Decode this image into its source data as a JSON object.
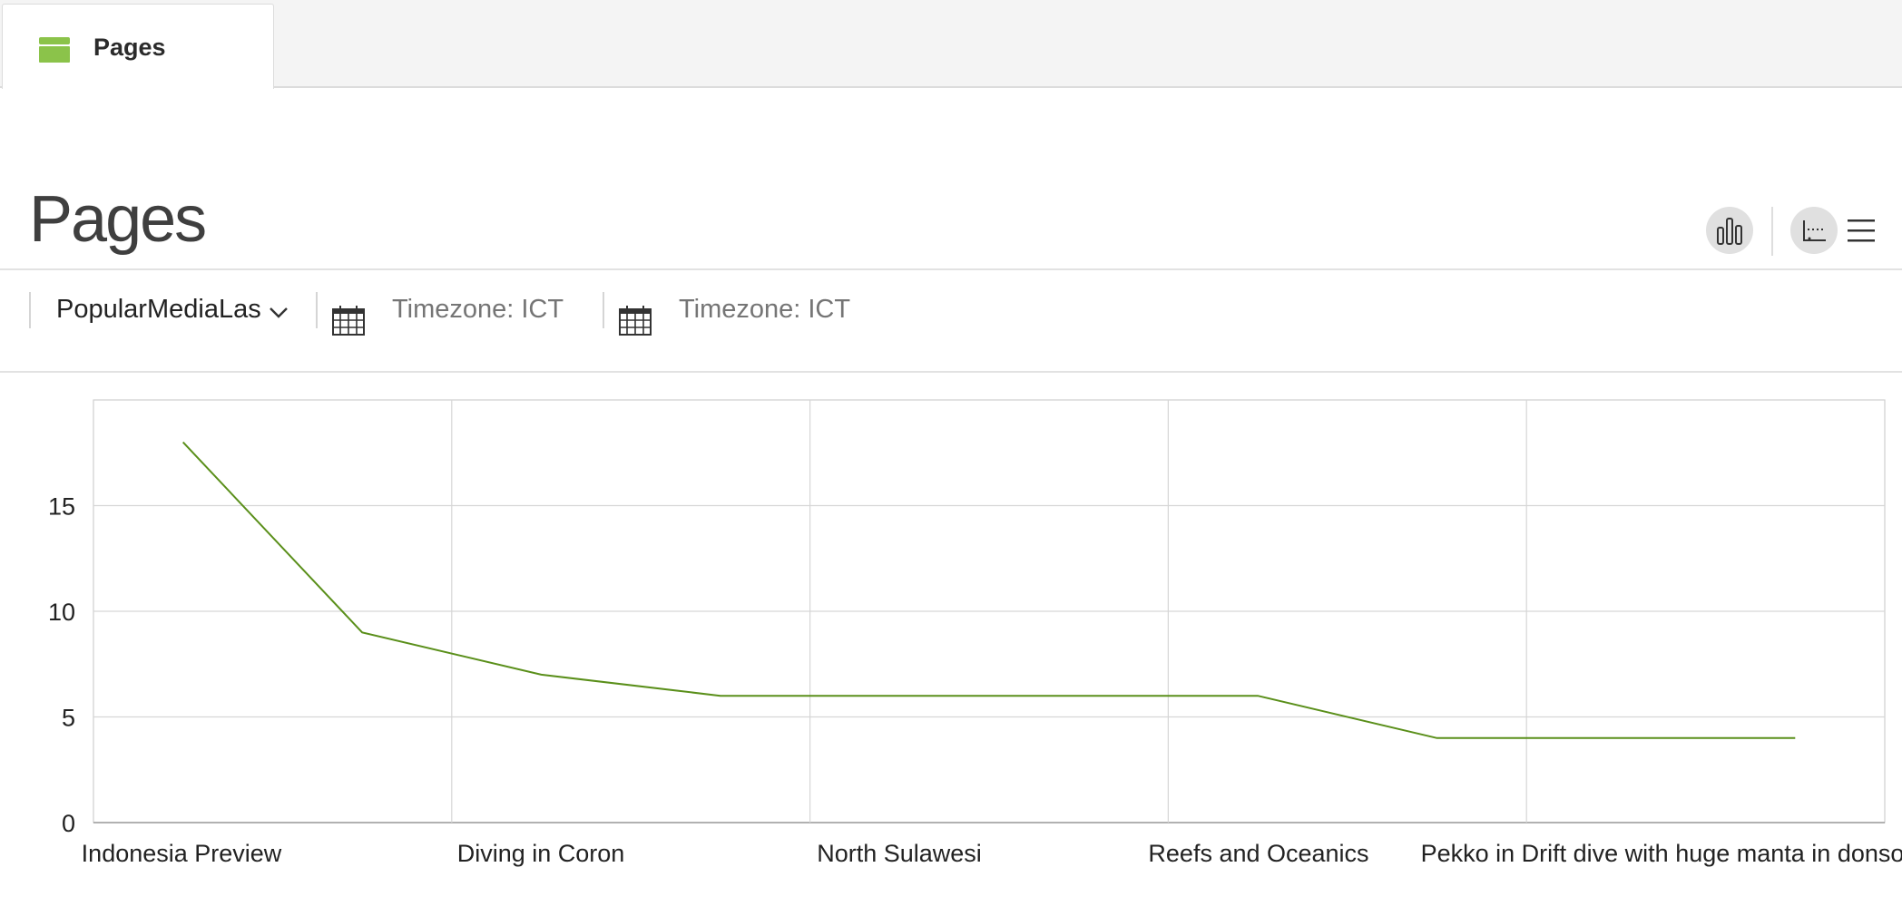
{
  "tab": {
    "label": "Pages",
    "icon": "folder-icon",
    "icon_color": "#8bc34a"
  },
  "page": {
    "title": "Pages"
  },
  "toolbar": {
    "chart_view_icon": "bar-chart-icon",
    "series_toggle_icon": "line-series-icon",
    "menu_icon": "hamburger-menu-icon"
  },
  "filters": {
    "report_select": {
      "value": "PopularMediaLast"
    },
    "start_date": {
      "placeholder": "Timezone: ICT",
      "icon": "calendar-icon"
    },
    "end_date": {
      "placeholder": "Timezone: ICT",
      "icon": "calendar-icon"
    }
  },
  "chart_data": {
    "type": "line",
    "x": [
      "Indonesia Preview",
      "",
      "Diving in Coron",
      "",
      "North Sulawesi",
      "",
      "Reefs and Oceanics",
      "Pekko in Drift dive with huge manta in donsol",
      "",
      ""
    ],
    "x_tick_labels": [
      "Indonesia Preview",
      "Diving in Coron",
      "North Sulawesi",
      "Reefs and Oceanics",
      "Pekko in Drift dive with huge manta in donsol"
    ],
    "series": [
      {
        "values": [
          18,
          9,
          7,
          6,
          6,
          6,
          6,
          4,
          4,
          4
        ],
        "color": "#5a8f1a"
      }
    ],
    "ylim": [
      0,
      20
    ],
    "yticks": [
      0,
      5,
      10,
      15
    ],
    "grid": true,
    "xlabel": "",
    "ylabel": ""
  }
}
